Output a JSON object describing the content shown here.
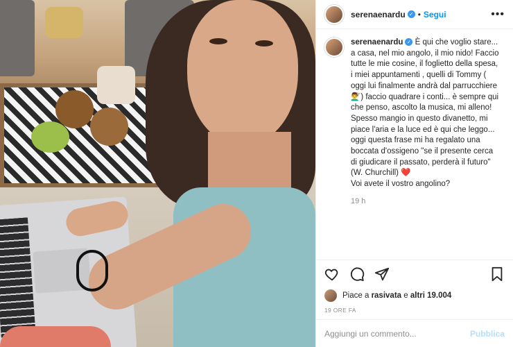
{
  "post": {
    "username": "serenaenardu",
    "follow_label": "Segui",
    "dot": "•",
    "more_label": "•••",
    "caption": {
      "username": "serenaenardu",
      "text_before_emoji": "È qui che voglio stare... a casa, nel mio angolo, il mio nido! Faccio tutte le mie cosine, il foglietto della spesa, i miei appuntamenti , quelli di Tommy ( oggi lui finalmente andrà dal parrucchiere 💇‍♂️) faccio quadrare i conti... è sempre qui che penso, ascolto la musica, mi alleno! Spesso mangio in questo divanetto, mi piace l'aria e la luce ed è qui che leggo... oggi questa frase mi ha regalato una boccata d'ossigeno \"se il presente cerca di giudicare il passato, perderà il futuro\" (W. Churchill)",
      "heart": "❤️",
      "text_after": "Voi avete il vostro angolino?",
      "time": "19 h"
    },
    "likes": {
      "prefix": "Piace a ",
      "user": "rasivata",
      "middle": " e ",
      "others": "altri 19.004"
    },
    "time_ago": "19 ORE FA",
    "comment": {
      "placeholder": "Aggiungi un commento...",
      "publish_label": "Pubblica"
    }
  },
  "icons": {
    "verified": "verified-badge-icon",
    "like": "heart-outline-icon",
    "comment": "comment-bubble-icon",
    "share": "paper-plane-icon",
    "save": "bookmark-icon"
  },
  "colors": {
    "link_blue": "#0095f6",
    "verified_blue": "#3897f0",
    "publish_disabled": "#b2dffc",
    "meta_grey": "#8e8e8e"
  }
}
